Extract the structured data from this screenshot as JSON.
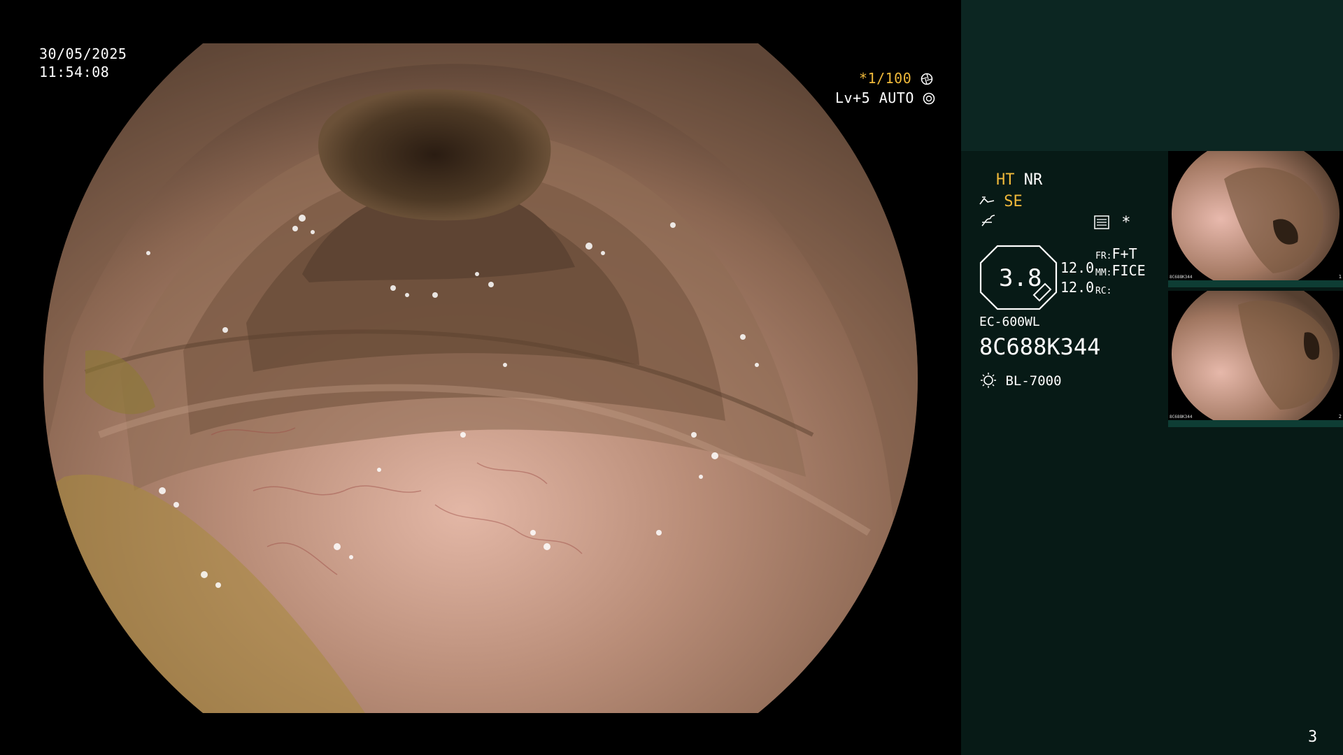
{
  "osd": {
    "date": "30/05/2025",
    "time": "11:54:08",
    "shutter": "*1/100",
    "level": "Lv+5",
    "mode": "AUTO"
  },
  "panel": {
    "ht": "HT",
    "nr": "NR",
    "se": "SE",
    "star": "*",
    "zoom": "3.8",
    "val1": "12.0",
    "val2": "12.0",
    "fr_label": "FR:",
    "fr_value": "F+T",
    "mm_label": "MM:",
    "mm_value": "FICE",
    "rc_label": "RC:",
    "scope_model": "EC-600WL",
    "serial": "8C688K344",
    "light_source": "BL-7000",
    "page_number": "3"
  },
  "thumbnails": [
    {
      "id": "8C688K344",
      "num": "1"
    },
    {
      "id": "8C688K344",
      "num": "2"
    }
  ],
  "colors": {
    "accent_yellow": "#f0b93a",
    "panel_bg": "#071a16",
    "panel_top_bg": "#0c2622",
    "thumb_bar": "#0e3d34"
  },
  "icons": {
    "shutter": "aperture-icon",
    "mode": "auto-iris-icon",
    "enhance": "curve-icon",
    "filter": "wave-icon",
    "record": "list-icon",
    "zoom": "zoom-octagon-icon",
    "light": "lamp-icon"
  }
}
